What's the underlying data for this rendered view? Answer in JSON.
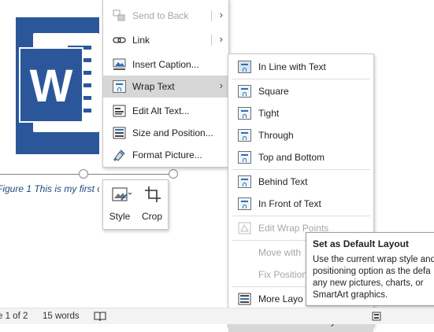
{
  "main_menu": {
    "items": [
      {
        "label": "Send to Back",
        "icon": "send-to-back-icon",
        "submenu": true,
        "disabled": true
      },
      {
        "label": "Link",
        "icon": "link-icon",
        "submenu": true
      },
      {
        "label": "Insert Caption...",
        "icon": "insert-caption-icon"
      },
      {
        "label": "Wrap Text",
        "icon": "wrap-text-icon",
        "submenu": true,
        "highlighted": true
      },
      {
        "label": "Edit Alt Text...",
        "icon": "alt-text-icon"
      },
      {
        "label": "Size and Position...",
        "icon": "size-position-icon"
      },
      {
        "label": "Format Picture...",
        "icon": "format-picture-icon"
      }
    ]
  },
  "wrap_submenu": {
    "items": [
      {
        "label": "In Line with Text",
        "icon": "in-line-with-text-icon"
      },
      {
        "label": "Square",
        "icon": "square-wrap-icon"
      },
      {
        "label": "Tight",
        "icon": "tight-wrap-icon"
      },
      {
        "label": "Through",
        "icon": "through-wrap-icon"
      },
      {
        "label": "Top and Bottom",
        "icon": "top-bottom-wrap-icon"
      },
      {
        "label": "Behind Text",
        "icon": "behind-text-icon"
      },
      {
        "label": "In Front of Text",
        "icon": "in-front-of-text-icon"
      },
      {
        "label": "Edit Wrap Points",
        "icon": "edit-wrap-points-icon",
        "disabled": true
      },
      {
        "label": "Move with",
        "disabled": true
      },
      {
        "label": "Fix Position",
        "disabled": true
      },
      {
        "label": "More Layo",
        "icon": "more-layout-icon"
      },
      {
        "label": "Set as Default Layout",
        "highlighted": true
      }
    ]
  },
  "mini_toolbar": {
    "style_label": "Style",
    "crop_label": "Crop"
  },
  "tooltip": {
    "title": "Set as Default Layout",
    "body": "Use the current wrap style and positioning option as the defa any new pictures, charts, or SmartArt graphics."
  },
  "document": {
    "caption": "Figure 1 This is my first ca"
  },
  "status_bar": {
    "page": "e 1 of 2",
    "words": "15 words"
  },
  "colors": {
    "word_blue": "#2b579a",
    "menu_highlight": "#d7d7d7",
    "caption_text": "#1f497d"
  }
}
